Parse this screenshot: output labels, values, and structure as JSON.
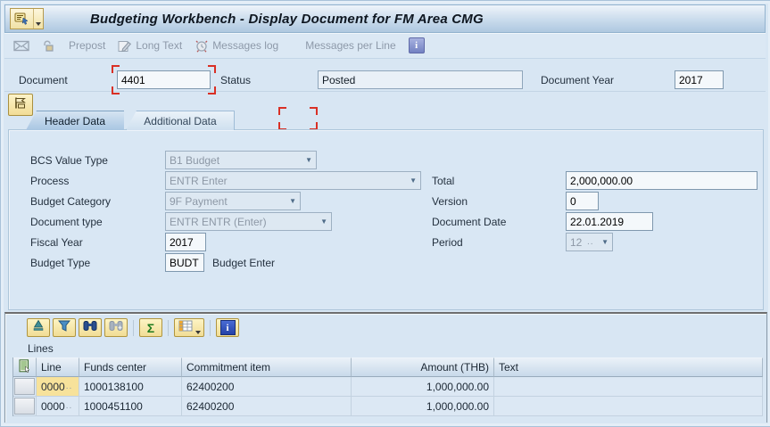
{
  "window": {
    "title": "Budgeting Workbench - Display Document for FM Area CMG"
  },
  "app_toolbar": {
    "prepost": "Prepost",
    "long_text": "Long Text",
    "messages_log": "Messages log",
    "messages_per_line": "Messages per Line"
  },
  "document_bar": {
    "document_label": "Document",
    "document_value": "4401",
    "status_label": "Status",
    "status_value": "Posted",
    "year_label": "Document Year",
    "year_value": "2017"
  },
  "tabs": {
    "header_data": "Header Data",
    "additional_data": "Additional Data"
  },
  "form": {
    "bcs_value_type": {
      "label": "BCS Value Type",
      "value": "B1 Budget"
    },
    "process": {
      "label": "Process",
      "value": "ENTR Enter"
    },
    "budget_category": {
      "label": "Budget Category",
      "value": "9F Payment"
    },
    "document_type": {
      "label": "Document type",
      "value": "ENTR ENTR (Enter)"
    },
    "fiscal_year": {
      "label": "Fiscal Year",
      "value": "2017"
    },
    "budget_type": {
      "label": "Budget Type",
      "value": "BUDT",
      "description": "Budget Enter"
    },
    "total": {
      "label": "Total",
      "value": "2,000,000.00"
    },
    "version": {
      "label": "Version",
      "value": "0"
    },
    "document_date": {
      "label": "Document Date",
      "value": "22.01.2019"
    },
    "period": {
      "label": "Period",
      "value": "12"
    }
  },
  "lines": {
    "panel_title": "Lines",
    "columns": {
      "line": "Line",
      "funds_center": "Funds center",
      "commitment_item": "Commitment item",
      "amount": "Amount (THB)",
      "text": "Text"
    },
    "rows": [
      {
        "line": "0000",
        "funds_center": "1000138100",
        "commitment_item": "62400200",
        "amount": "1,000,000.00",
        "text": ""
      },
      {
        "line": "0000",
        "funds_center": "1000451100",
        "commitment_item": "62400200",
        "amount": "1,000,000.00",
        "text": ""
      }
    ]
  },
  "icons": {
    "sum_glyph": "Σ",
    "info_glyph": "i",
    "dropdown_glyph": "▼",
    "truncation_glyph": ".."
  },
  "colors": {
    "background": "#d8e6f3",
    "titlebar_bottom": "#aec8e0",
    "active_tab": "#a9c6e2",
    "selected_cell_yellow": "#f7e29b",
    "bracket_red": "#d93025",
    "grid_row": "#dce8f4"
  }
}
